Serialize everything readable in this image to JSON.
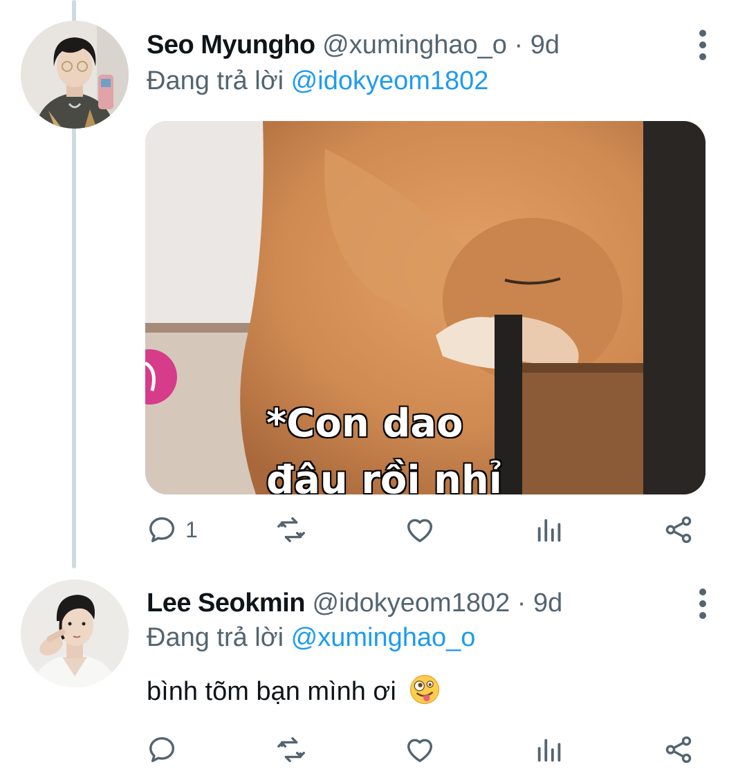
{
  "tweets": [
    {
      "name": "Seo Myungho",
      "handle": "@xuminghao_o",
      "separator": "·",
      "time": "9d",
      "reply_prefix": "Đang trả lời",
      "reply_to": "@idokyeom1802",
      "media": {
        "caption_line1": "*Con dao",
        "caption_line2": "đâu rồi nhỉ"
      },
      "actions": {
        "reply_count": "1",
        "retweet_count": "",
        "like_count": ""
      }
    },
    {
      "name": "Lee Seokmin",
      "handle": "@idokyeom1802",
      "separator": "·",
      "time": "9d",
      "reply_prefix": "Đang trả lời",
      "reply_to": "@xuminghao_o",
      "text": "bình tõm bạn mình ơi",
      "emoji": "zany-face",
      "actions": {
        "reply_count": "",
        "retweet_count": "",
        "like_count": ""
      }
    }
  ],
  "colors": {
    "text": "#0f1419",
    "secondary": "#536471",
    "accent": "#1d9bf0",
    "thread_line": "#cfd9de"
  },
  "icons": [
    "reply-icon",
    "retweet-icon",
    "like-icon",
    "views-icon",
    "share-icon",
    "more-icon"
  ]
}
